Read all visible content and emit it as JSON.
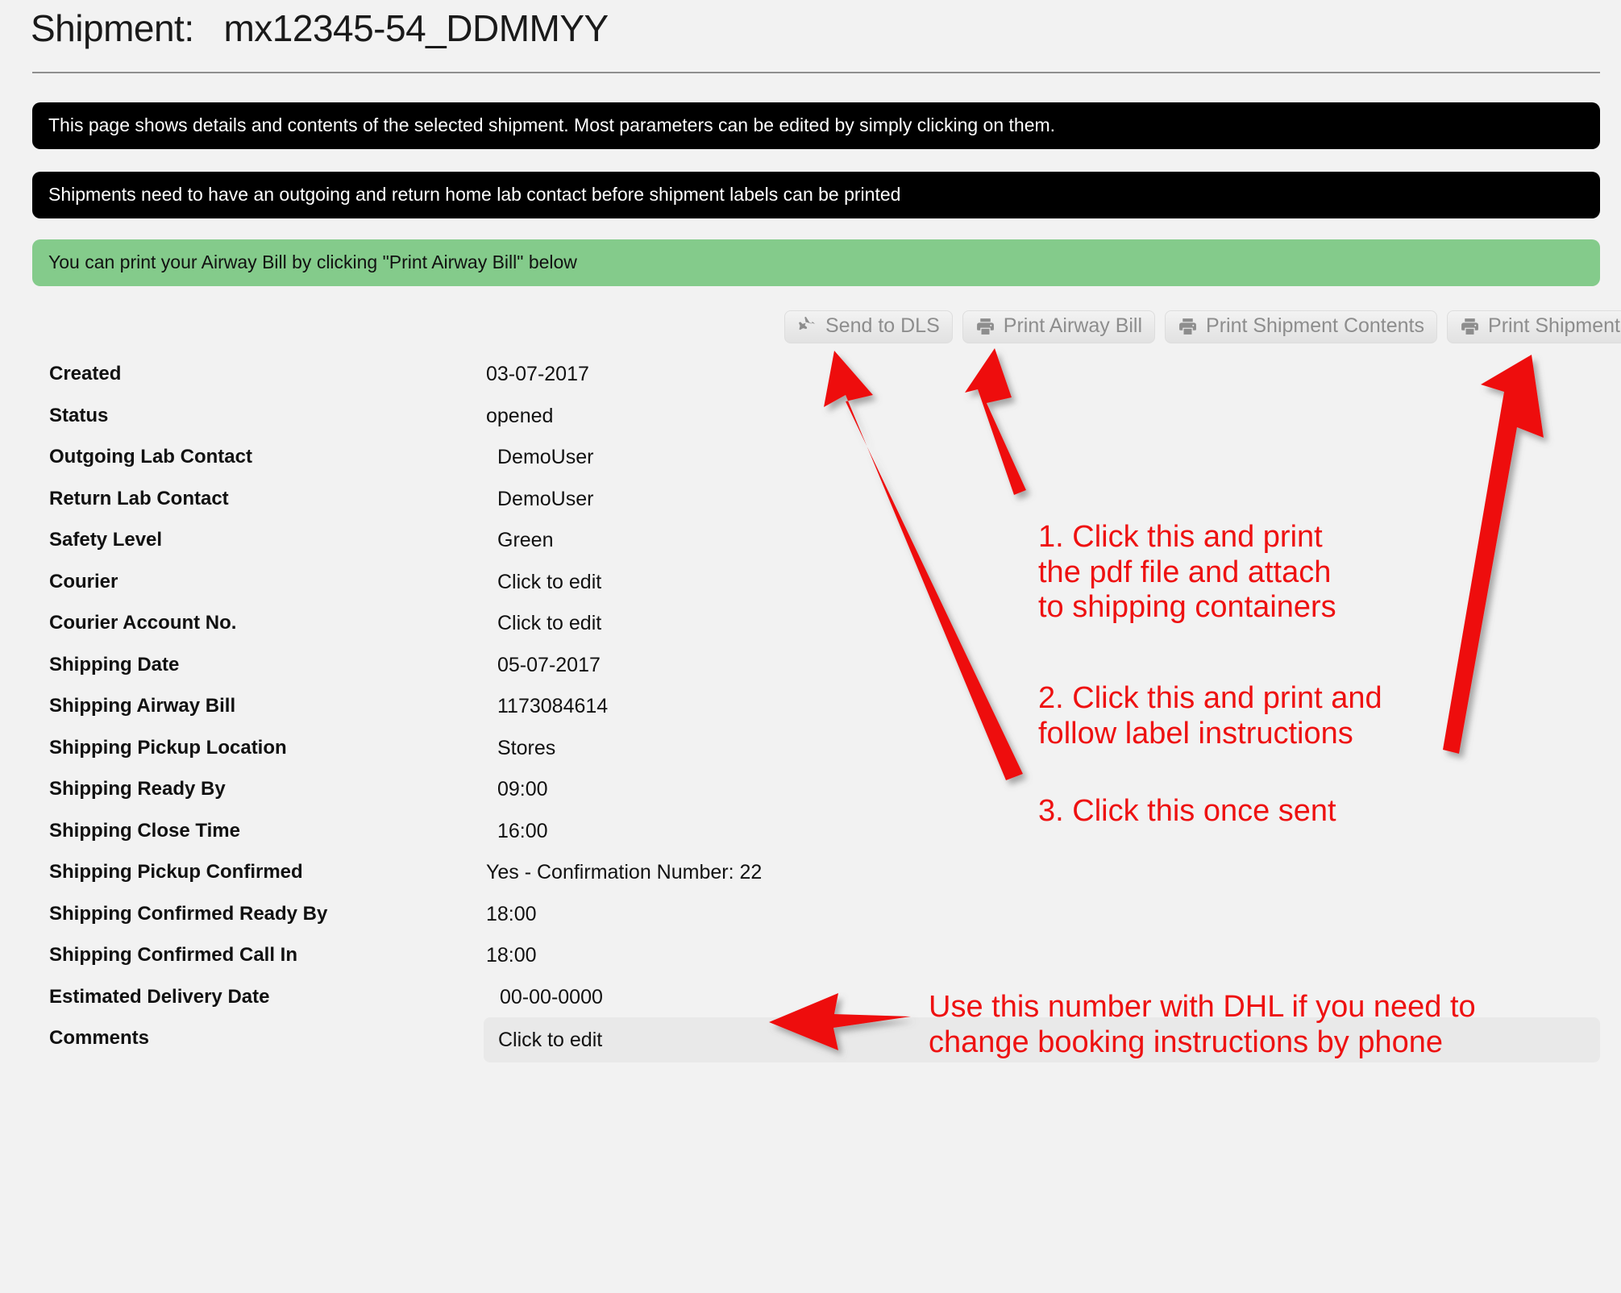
{
  "page": {
    "title_prefix": "Shipment:",
    "title_value": "mx12345-54_DDMMYY",
    "title_full": "Shipment:   mx12345-54_DDMMYY"
  },
  "alerts": [
    {
      "style": "dark",
      "text": "This page shows details and contents of the selected shipment. Most parameters can be edited by simply clicking on them."
    },
    {
      "style": "dark",
      "text": "Shipments need to have an outgoing and return home lab contact before shipment labels can be printed"
    },
    {
      "style": "green",
      "text": "You can print your Airway Bill by clicking \"Print Airway Bill\" below"
    }
  ],
  "toolbar": {
    "buttons": [
      {
        "label": "Send to DLS",
        "icon": "plane-icon"
      },
      {
        "label": "Print Airway Bill",
        "icon": "printer-icon"
      },
      {
        "label": "Print Shipment Contents",
        "icon": "printer-icon"
      },
      {
        "label": "Print Shipment Labels",
        "icon": "printer-icon"
      }
    ]
  },
  "details": {
    "rows": [
      {
        "label": "Created",
        "value": "03-07-2017",
        "value_x": 603
      },
      {
        "label": "Status",
        "value": "opened",
        "value_x": 603
      },
      {
        "label": "Outgoing Lab Contact",
        "value": "DemoUser",
        "value_x": 617
      },
      {
        "label": "Return Lab Contact",
        "value": "DemoUser",
        "value_x": 617
      },
      {
        "label": "Safety Level",
        "value": "Green",
        "value_x": 617
      },
      {
        "label": "Courier",
        "value": "Click to edit",
        "value_x": 617
      },
      {
        "label": "Courier Account No.",
        "value": "Click to edit",
        "value_x": 617
      },
      {
        "label": "Shipping Date",
        "value": "05-07-2017",
        "value_x": 617
      },
      {
        "label": "Shipping Airway Bill",
        "value": "1173084614",
        "value_x": 617
      },
      {
        "label": "Shipping Pickup Location",
        "value": "Stores",
        "value_x": 617
      },
      {
        "label": "Shipping Ready By",
        "value": "09:00",
        "value_x": 617
      },
      {
        "label": "Shipping Close Time",
        "value": "16:00",
        "value_x": 617
      },
      {
        "label": "Shipping Pickup Confirmed",
        "value": "Yes - Confirmation Number: 22",
        "value_x": 603
      },
      {
        "label": "Shipping Confirmed Ready By",
        "value": "18:00",
        "value_x": 603
      },
      {
        "label": "Shipping Confirmed Call In",
        "value": "18:00",
        "value_x": 603
      },
      {
        "label": "Estimated Delivery Date",
        "value": "00-00-0000",
        "value_x": 620
      },
      {
        "label": "Comments",
        "value": "Click to edit",
        "value_x": 618,
        "editable_box": true
      }
    ]
  },
  "annotations": {
    "note_1": "1. Click this and print\nthe pdf file and attach\nto shipping containers",
    "note_2": "2. Click this and print and\nfollow label instructions",
    "note_3": "3. Click this once sent",
    "note_4": "Use this number with DHL if you need to\nchange booking instructions by phone"
  },
  "colors": {
    "accent_red": "#ee1111",
    "alert_dark_bg": "#000000",
    "alert_green_bg": "#84cb8b",
    "page_bg": "#f2f2f2",
    "button_bg": "#e9e9e9",
    "button_text": "#8d8d8d"
  }
}
